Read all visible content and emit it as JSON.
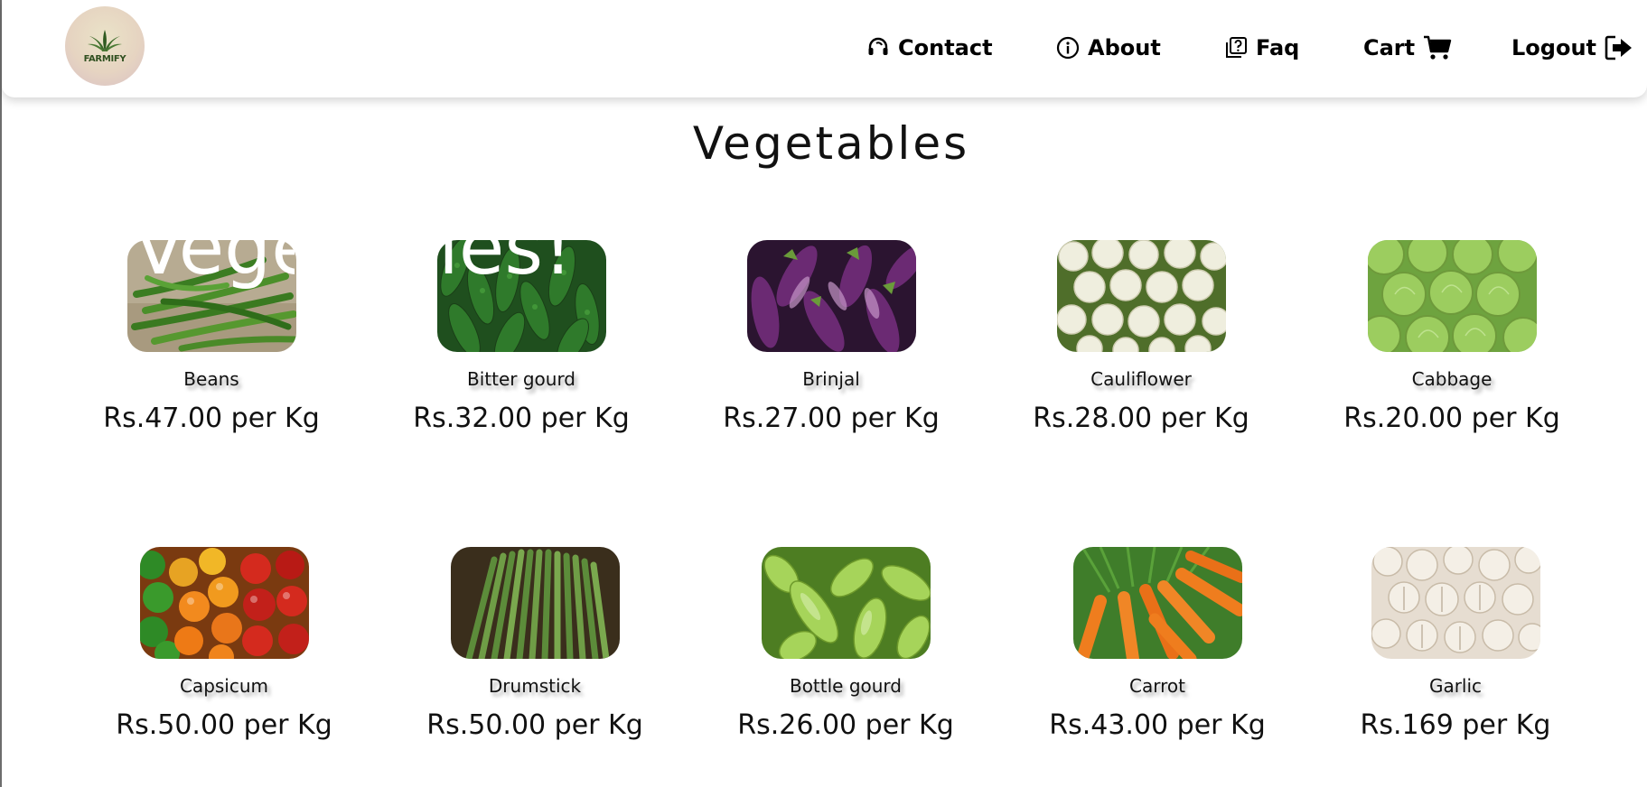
{
  "nav": {
    "logo_text": "FARMIFY",
    "links": [
      {
        "label": "Contact",
        "icon": "headset-icon"
      },
      {
        "label": "About",
        "icon": "info-circle-icon"
      },
      {
        "label": "Faq",
        "icon": "question-box-icon"
      },
      {
        "label": "Cart",
        "icon": "cart-icon"
      },
      {
        "label": "Logout",
        "icon": "logout-icon"
      }
    ]
  },
  "page": {
    "title": "Vegetables",
    "overlay_heading": "Vegetables!"
  },
  "products": [
    {
      "name": "Beans",
      "price": "Rs.47.00 per Kg",
      "image": "beans"
    },
    {
      "name": "Bitter gourd",
      "price": "Rs.32.00 per Kg",
      "image": "bitter-gourd"
    },
    {
      "name": "Brinjal",
      "price": "Rs.27.00 per Kg",
      "image": "brinjal"
    },
    {
      "name": "Cauliflower",
      "price": "Rs.28.00 per Kg",
      "image": "cauliflower"
    },
    {
      "name": "Cabbage",
      "price": "Rs.20.00 per Kg",
      "image": "cabbage"
    },
    {
      "name": "Capsicum",
      "price": "Rs.50.00 per Kg",
      "image": "capsicum"
    },
    {
      "name": "Drumstick",
      "price": "Rs.50.00 per Kg",
      "image": "drumstick"
    },
    {
      "name": "Bottle gourd",
      "price": "Rs.26.00 per Kg",
      "image": "bottle-gourd"
    },
    {
      "name": "Carrot",
      "price": "Rs.43.00 per Kg",
      "image": "carrot"
    },
    {
      "name": "Garlic",
      "price": "Rs.169 per Kg",
      "image": "garlic"
    }
  ],
  "colors": {
    "background": "#ffffff",
    "text": "#111111",
    "nav_shadow": "#c8c8c8"
  }
}
